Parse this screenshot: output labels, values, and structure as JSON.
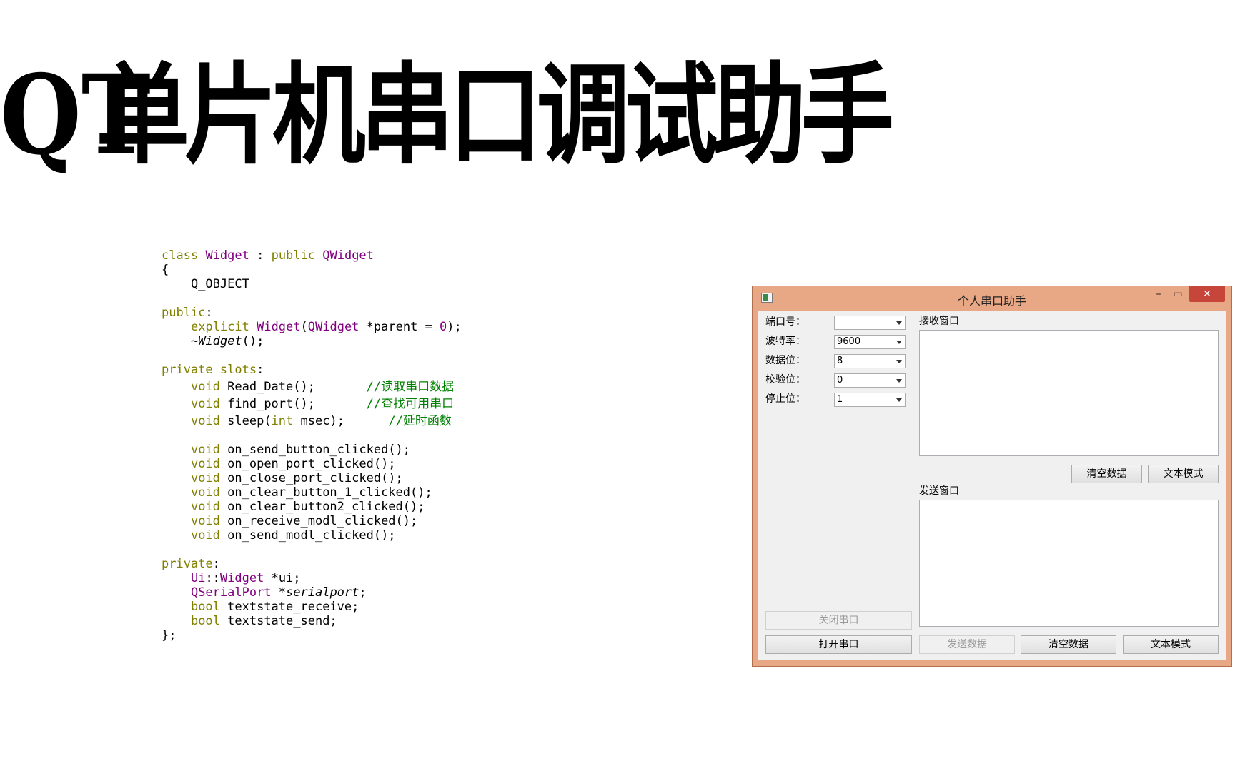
{
  "title": {
    "chars": [
      "QT",
      "单",
      "片",
      "机",
      "串",
      "口",
      "调",
      "试",
      "助",
      "手"
    ]
  },
  "code": {
    "l1": {
      "a": "class",
      "b": " ",
      "c": "Widget",
      "d": " : ",
      "e": "public",
      "f": " ",
      "g": "QWidget"
    },
    "l2": {
      "a": "{"
    },
    "l3": {
      "a": "    Q_OBJECT"
    },
    "l4": {
      "a": "public",
      "b": ":"
    },
    "l5": {
      "pre": "    ",
      "a": "explicit",
      "b": " ",
      "c": "Widget",
      "d": "(",
      "e": "QWidget",
      "f": " *parent = ",
      "g": "0",
      "h": ");"
    },
    "l6": {
      "pre": "    ~",
      "a": "Widget",
      "b": "();"
    },
    "l7": {
      "a": "private slots",
      "b": ":"
    },
    "l8": {
      "pre": "    ",
      "a": "void",
      "b": " Read_Date();       ",
      "c": "//读取串口数据"
    },
    "l9": {
      "pre": "    ",
      "a": "void",
      "b": " find_port();       ",
      "c": "//查找可用串口"
    },
    "l10": {
      "pre": "    ",
      "a": "void",
      "b": " sleep(",
      "c": "int",
      "d": " msec);      ",
      "e": "//延时函数"
    },
    "l11": {
      "pre": "    ",
      "a": "void",
      "b": " on_send_button_clicked();"
    },
    "l12": {
      "pre": "    ",
      "a": "void",
      "b": " on_open_port_clicked();"
    },
    "l13": {
      "pre": "    ",
      "a": "void",
      "b": " on_close_port_clicked();"
    },
    "l14": {
      "pre": "    ",
      "a": "void",
      "b": " on_clear_button_1_clicked();"
    },
    "l15": {
      "pre": "    ",
      "a": "void",
      "b": " on_clear_button2_clicked();"
    },
    "l16": {
      "pre": "    ",
      "a": "void",
      "b": " on_receive_modl_clicked();"
    },
    "l17": {
      "pre": "    ",
      "a": "void",
      "b": " on_send_modl_clicked();"
    },
    "l18": {
      "a": "private",
      "b": ":"
    },
    "l19": {
      "pre": "    ",
      "a": "Ui",
      "b": "::",
      "c": "Widget",
      "d": " *ui;"
    },
    "l20": {
      "pre": "    ",
      "a": "QSerialPort",
      "b": " *",
      "c": "serialport",
      "d": ";"
    },
    "l21": {
      "pre": "    ",
      "a": "bool",
      "b": " textstate_receive;"
    },
    "l22": {
      "pre": "    ",
      "a": "bool",
      "b": " textstate_send;"
    },
    "l23": {
      "a": "};"
    }
  },
  "window": {
    "title": "个人串口助手",
    "minimize": "–",
    "maximize": "▭",
    "close": "✕",
    "settings": [
      {
        "label": "端口号：",
        "value": ""
      },
      {
        "label": "波特率：",
        "value": "9600"
      },
      {
        "label": "数据位：",
        "value": "8"
      },
      {
        "label": "校验位：",
        "value": "0"
      },
      {
        "label": "停止位：",
        "value": "1"
      }
    ],
    "receive_label": "接收窗口",
    "send_label": "发送窗口",
    "recv_clear": "清空数据",
    "recv_mode": "文本模式",
    "close_port": "关闭串口",
    "open_port": "打开串口",
    "send_data": "发送数据",
    "send_clear": "清空数据",
    "send_mode": "文本模式"
  },
  "colors": {
    "window_frame": "#e9a885",
    "close_button": "#c7463c",
    "keyword": "#808000",
    "type": "#800080",
    "comment": "#008000"
  }
}
